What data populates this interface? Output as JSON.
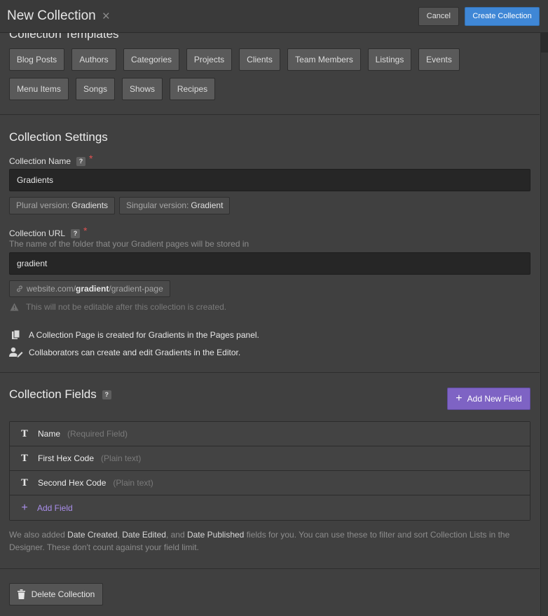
{
  "header": {
    "title": "New Collection",
    "close_icon": "×",
    "cancel_label": "Cancel",
    "create_label": "Create Collection"
  },
  "templates": {
    "title": "Collection Templates",
    "items": [
      "Blog Posts",
      "Authors",
      "Categories",
      "Projects",
      "Clients",
      "Team Members",
      "Listings",
      "Events",
      "Menu Items",
      "Songs",
      "Shows",
      "Recipes"
    ]
  },
  "settings": {
    "title": "Collection Settings",
    "name_label": "Collection Name",
    "help_badge": "?",
    "required_mark": "*",
    "name_value": "Gradients",
    "plural_label": "Plural version:",
    "plural_value": "Gradients",
    "singular_label": "Singular version:",
    "singular_value": "Gradient",
    "url_label": "Collection URL",
    "url_hint": "The name of the folder that your Gradient pages will be stored in",
    "url_value": "gradient",
    "url_preview_prefix": "website.com/",
    "url_preview_slug": "gradient",
    "url_preview_suffix": "/gradient-page",
    "warning": "This will not be editable after this collection is created.",
    "info_pages": "A Collection Page is created for Gradients in the Pages panel.",
    "info_editor": "Collaborators can create and edit Gradients in the Editor."
  },
  "fields": {
    "title": "Collection Fields",
    "add_new_label": "Add New Field",
    "rows": [
      {
        "name": "Name",
        "type": "(Required Field)"
      },
      {
        "name": "First Hex Code",
        "type": "(Plain text)"
      },
      {
        "name": "Second Hex Code",
        "type": "(Plain text)"
      }
    ],
    "add_field_label": "Add Field",
    "note_part1": "We also added ",
    "note_date_created": "Date Created",
    "note_sep1": ", ",
    "note_date_edited": "Date Edited",
    "note_sep2": ", and ",
    "note_date_published": "Date Published",
    "note_part2": " fields for you. You can use these to filter and sort Collection Lists in the Designer. These don't count against your field limit."
  },
  "footer": {
    "delete_label": "Delete Collection"
  },
  "colors": {
    "primary": "#3f87d6",
    "accent": "#7e63c4",
    "required": "#e05252"
  }
}
